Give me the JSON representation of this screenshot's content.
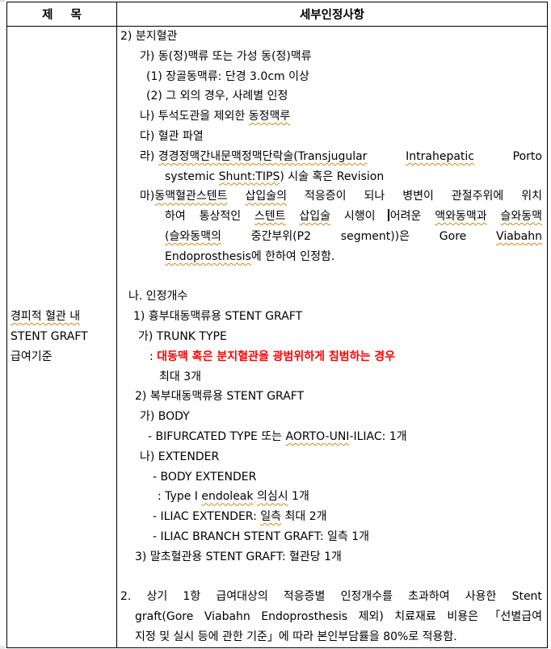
{
  "table": {
    "headers": {
      "title_col_part1": "제",
      "title_col_part2": "목",
      "detail_col": "세부인정사항"
    },
    "row_title": {
      "line1": "경피적 혈관 내",
      "line2": "STENT GRAFT",
      "line3": "급여기준"
    },
    "details": {
      "branch_vessel": {
        "heading": "2) 분지혈관",
        "ga": "가) 동(정)맥류 또는 가성 동(정)맥류",
        "ga_1": "(1) 장골동맥류: 단경 3.0cm 이상",
        "ga_2": "(2) 그 외의 경우, 사례별 인정",
        "na_prefix": "나) 투석도관을 제외한 ",
        "na_sq": "동정맥루",
        "da": "다) 혈관 파열",
        "ra_prefix": "라) ",
        "ra_sq1": "경경정맥간내문맥정맥단락술(Transjugular",
        "ra_sq2": "Intrahepatic",
        "ra_tail": "Porto",
        "ra_line2_a": "systemic ",
        "ra_line2_sq": "Shunt:TIPS",
        "ra_line2_b": ") 시술 혹은 Revision",
        "ma_prefix": "마) ",
        "ma_sq1": "동맥혈관스텐트",
        "ma_a": " ",
        "ma_sq2": "삽입술의",
        "ma_b": " 적응증이 되나 병변이 관절주위에 위치",
        "ma_l2_a": "하여 통상적인 ",
        "ma_l2_sq1": "스텐트",
        "ma_l2_b": " ",
        "ma_l2_sq2": "삽입술",
        "ma_l2_c": " 시행이 ",
        "ma_l2_d": "어려운 ",
        "ma_l2_sq3": "액와동맥과",
        "ma_l2_e": " ",
        "ma_l2_sq4": "슬와동맥",
        "ma_l3_sq1": "(슬와동맥의",
        "ma_l3_b": "중간부위(P2",
        "ma_l3_c": "segment))은",
        "ma_l3_d": "Gore",
        "ma_l3_sq2": "Viabahn",
        "ma_l4_sq": "Endoprosthesis",
        "ma_l4_b": "에 한하여 인정함."
      },
      "count": {
        "heading": "나. 인정개수",
        "thoracic": "1) 흉부대동맥류용 STENT GRAFT",
        "trunk": "가) TRUNK TYPE",
        "trunk_colon": ": ",
        "trunk_red": "대동맥 혹은 분지혈관을 광범위하게 침범하는 경우",
        "trunk_max": "최대 3개",
        "abdominal": "2) 복부대동맥류용 STENT GRAFT",
        "body": "가) BODY",
        "bifurcated_a": "- BIFURCATED TYPE 또는 ",
        "bifurcated_sq": "AORTO-UNI",
        "bifurcated_b": "-ILIAC: 1개",
        "extender": "나) EXTENDER",
        "body_extender": "- BODY EXTENDER",
        "type1_a": ": Type Ⅰ ",
        "type1_sq1": "endoleak",
        "type1_b": " ",
        "type1_sq2": "의심시",
        "type1_c": " 1개",
        "iliac_ext_a": "- ILIAC EXTENDER: ",
        "iliac_ext_sq": "일측",
        "iliac_ext_b": " 최대 2개",
        "iliac_branch": "- ILIAC BRANCH STENT GRAFT: 일측 1개",
        "peripheral": "3) 말초혈관용 STENT GRAFT: 혈관당 1개"
      },
      "excess": {
        "line1": "2. 상기 1항 급여대상의 적응증별 인정개수를 초과하여 사용한 Stent",
        "line2": "graft(Gore Viabahn Endoprosthesis 제외) 치료재료 비용은 「선별급여",
        "line3": "지정 및 실시 등에 관한 기준」에 따라 본인부담률을 80%로 적용함."
      }
    }
  },
  "colors": {
    "highlight_text": "#ff0000",
    "spellcheck_underline": "#d08a1c"
  }
}
